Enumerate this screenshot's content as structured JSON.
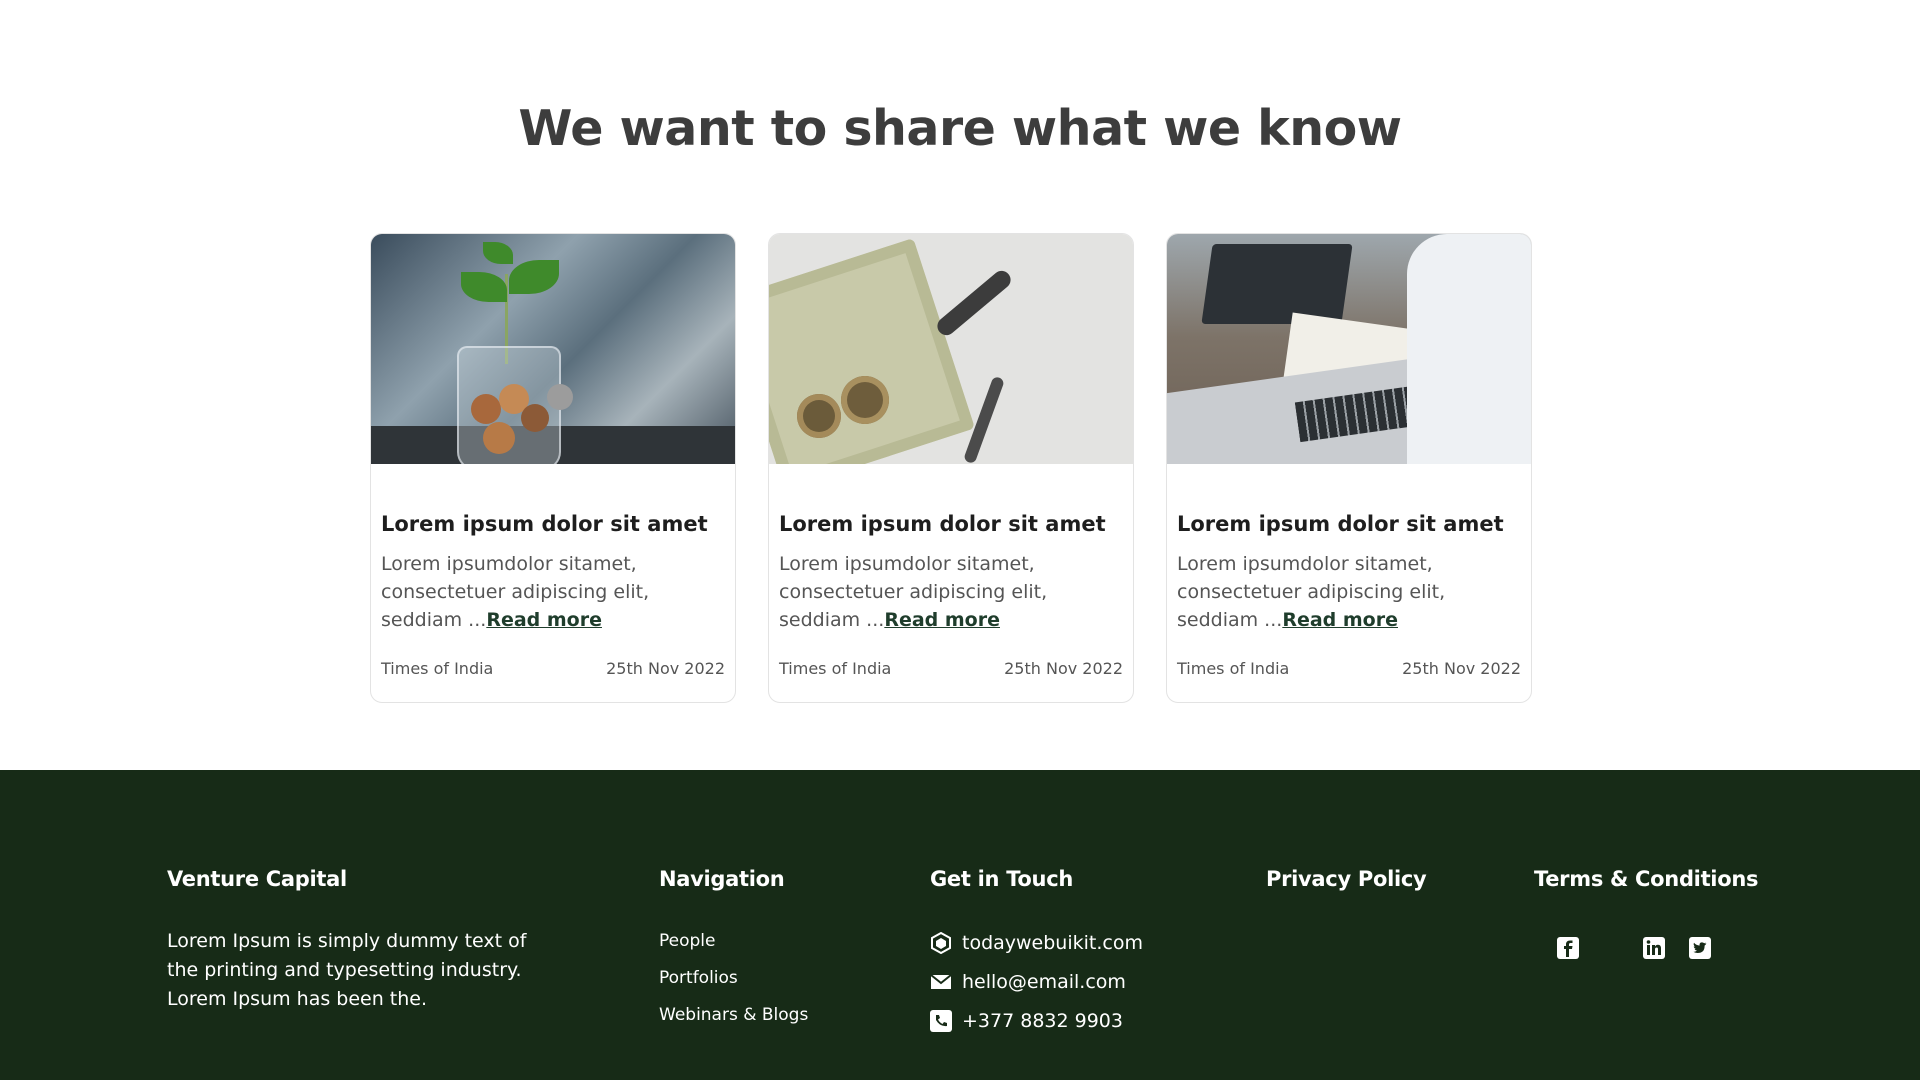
{
  "section": {
    "title": "We want to share what we know"
  },
  "cards": [
    {
      "title": "Lorem ipsum dolor sit amet",
      "text": "Lorem ipsumdolor sitamet, consectetuer adipiscing elit, seddiam ...",
      "read_more": "Read more",
      "source": "Times of India",
      "date": "25th Nov 2022"
    },
    {
      "title": "Lorem ipsum dolor sit amet",
      "text": "Lorem ipsumdolor sitamet, consectetuer adipiscing elit, seddiam ...",
      "read_more": "Read more",
      "source": "Times of India",
      "date": "25th Nov 2022"
    },
    {
      "title": "Lorem ipsum dolor sit amet",
      "text": "Lorem ipsumdolor sitamet, consectetuer adipiscing elit, seddiam ...",
      "read_more": "Read more",
      "source": "Times of India",
      "date": "25th Nov 2022"
    }
  ],
  "footer": {
    "brand": {
      "title": "Venture Capital",
      "description": "Lorem Ipsum is simply dummy text of the printing and typesetting industry. Lorem Ipsum has been the."
    },
    "navigation": {
      "title": "Navigation",
      "items": [
        "People",
        "Portfolios",
        "Webinars & Blogs"
      ]
    },
    "contact": {
      "title": "Get in Touch",
      "website": "todaywebuikit.com",
      "email": "hello@email.com",
      "phone": "+377 8832 9903"
    },
    "privacy": {
      "title": "Privacy Policy"
    },
    "terms": {
      "title": "Terms & Conditions"
    },
    "social_icons": [
      "facebook-icon",
      "linkedin-icon",
      "twitter-icon"
    ]
  },
  "colors": {
    "footer_bg": "#172b17",
    "heading": "#3d3d3d",
    "link": "#1f3d2c"
  }
}
